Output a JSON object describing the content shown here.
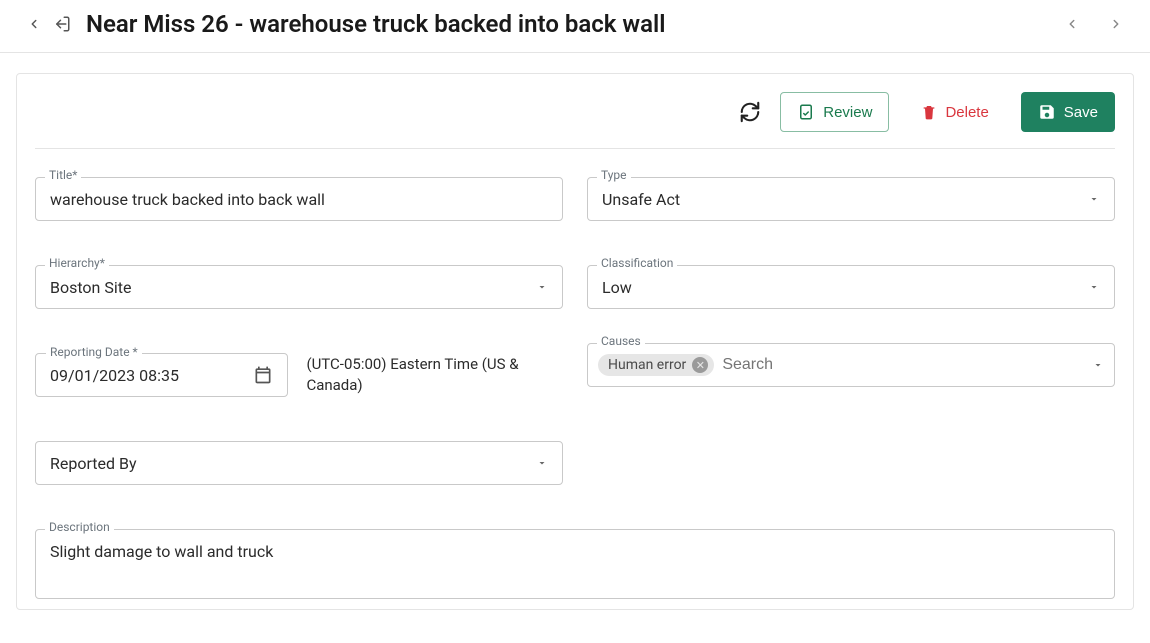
{
  "header": {
    "title": "Near Miss 26 - warehouse truck backed into back wall"
  },
  "actions": {
    "review_label": "Review",
    "delete_label": "Delete",
    "save_label": "Save"
  },
  "form": {
    "title": {
      "label": "Title*",
      "value": "warehouse truck backed into back wall"
    },
    "type": {
      "label": "Type",
      "value": "Unsafe Act"
    },
    "hierarchy": {
      "label": "Hierarchy*",
      "value": "Boston Site"
    },
    "classification": {
      "label": "Classification",
      "value": "Low"
    },
    "reporting_date": {
      "label": "Reporting Date *",
      "value": "09/01/2023 08:35",
      "timezone": "(UTC-05:00) Eastern Time (US & Canada)"
    },
    "causes": {
      "label": "Causes",
      "chip": "Human error",
      "placeholder": "Search"
    },
    "reported_by": {
      "label": "Reported By"
    },
    "description": {
      "label": "Description",
      "value": "Slight damage to wall and truck"
    }
  }
}
